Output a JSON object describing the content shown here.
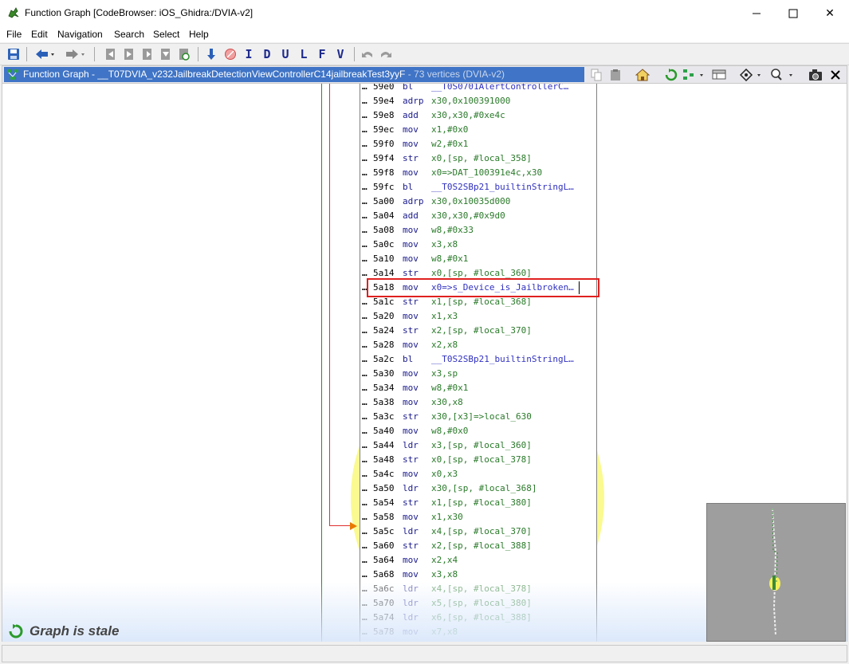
{
  "window": {
    "title": "Function Graph [CodeBrowser: iOS_Ghidra:/DVIA-v2]",
    "minimize_icon": "minimize-icon",
    "maximize_icon": "maximize-icon",
    "close_glyph": "✕"
  },
  "menu": [
    "File",
    "Edit",
    "Navigation",
    "Search",
    "Select",
    "Help"
  ],
  "toolbar": {
    "letters": [
      "I",
      "D",
      "U",
      "L",
      "F",
      "V"
    ]
  },
  "graph_header": {
    "title": "Function Graph - __T07DVIA_v232JailbreakDetectionViewControllerC14jailbreakTest3yyF",
    "vertices": " - 73 vertices  (DVIA-v2)"
  },
  "code": [
    {
      "dots": "…",
      "addr": "59e0",
      "mnemonic": "bl",
      "operands": "__T0S0701AlertControllerC…",
      "kind": "lbl"
    },
    {
      "dots": "…",
      "addr": "59e4",
      "mnemonic": "adrp",
      "operands": "x30,0x100391000",
      "kind": "num"
    },
    {
      "dots": "…",
      "addr": "59e8",
      "mnemonic": "add",
      "operands": "x30,x30,#0xe4c",
      "kind": "num"
    },
    {
      "dots": "…",
      "addr": "59ec",
      "mnemonic": "mov",
      "operands": "x1,#0x0",
      "kind": "num"
    },
    {
      "dots": "…",
      "addr": "59f0",
      "mnemonic": "mov",
      "operands": "w2,#0x1",
      "kind": "num"
    },
    {
      "dots": "…",
      "addr": "59f4",
      "mnemonic": "str",
      "operands": "x0,[sp, #local_358]",
      "kind": "num"
    },
    {
      "dots": "…",
      "addr": "59f8",
      "mnemonic": "mov",
      "operands": "x0=>DAT_100391e4c,x30",
      "kind": "num"
    },
    {
      "dots": "…",
      "addr": "59fc",
      "mnemonic": "bl",
      "operands": "__T0S2SBp21_builtinStringL…",
      "kind": "lbl"
    },
    {
      "dots": "…",
      "addr": "5a00",
      "mnemonic": "adrp",
      "operands": "x30,0x10035d000",
      "kind": "num"
    },
    {
      "dots": "…",
      "addr": "5a04",
      "mnemonic": "add",
      "operands": "x30,x30,#0x9d0",
      "kind": "num"
    },
    {
      "dots": "…",
      "addr": "5a08",
      "mnemonic": "mov",
      "operands": "w8,#0x33",
      "kind": "num"
    },
    {
      "dots": "…",
      "addr": "5a0c",
      "mnemonic": "mov",
      "operands": "x3,x8",
      "kind": "num"
    },
    {
      "dots": "…",
      "addr": "5a10",
      "mnemonic": "mov",
      "operands": "w8,#0x1",
      "kind": "num"
    },
    {
      "dots": "…",
      "addr": "5a14",
      "mnemonic": "str",
      "operands": "x0,[sp, #local_360]",
      "kind": "num"
    },
    {
      "dots": "…",
      "addr": "5a18",
      "mnemonic": "mov",
      "operands": "x0=>s_Device_is_Jailbroken…",
      "kind": "lbl"
    },
    {
      "dots": "…",
      "addr": "5a1c",
      "mnemonic": "str",
      "operands": "x1,[sp, #local_368]",
      "kind": "num"
    },
    {
      "dots": "…",
      "addr": "5a20",
      "mnemonic": "mov",
      "operands": "x1,x3",
      "kind": "num"
    },
    {
      "dots": "…",
      "addr": "5a24",
      "mnemonic": "str",
      "operands": "x2,[sp, #local_370]",
      "kind": "num"
    },
    {
      "dots": "…",
      "addr": "5a28",
      "mnemonic": "mov",
      "operands": "x2,x8",
      "kind": "num"
    },
    {
      "dots": "…",
      "addr": "5a2c",
      "mnemonic": "bl",
      "operands": "__T0S2SBp21_builtinStringL…",
      "kind": "lbl"
    },
    {
      "dots": "…",
      "addr": "5a30",
      "mnemonic": "mov",
      "operands": "x3,sp",
      "kind": "num"
    },
    {
      "dots": "…",
      "addr": "5a34",
      "mnemonic": "mov",
      "operands": "w8,#0x1",
      "kind": "num"
    },
    {
      "dots": "…",
      "addr": "5a38",
      "mnemonic": "mov",
      "operands": "x30,x8",
      "kind": "num"
    },
    {
      "dots": "…",
      "addr": "5a3c",
      "mnemonic": "str",
      "operands": "x30,[x3]=>local_630",
      "kind": "num"
    },
    {
      "dots": "…",
      "addr": "5a40",
      "mnemonic": "mov",
      "operands": "w8,#0x0",
      "kind": "num"
    },
    {
      "dots": "…",
      "addr": "5a44",
      "mnemonic": "ldr",
      "operands": "x3,[sp, #local_360]",
      "kind": "num"
    },
    {
      "dots": "…",
      "addr": "5a48",
      "mnemonic": "str",
      "operands": "x0,[sp, #local_378]",
      "kind": "num"
    },
    {
      "dots": "…",
      "addr": "5a4c",
      "mnemonic": "mov",
      "operands": "x0,x3",
      "kind": "num"
    },
    {
      "dots": "…",
      "addr": "5a50",
      "mnemonic": "ldr",
      "operands": "x30,[sp, #local_368]",
      "kind": "num"
    },
    {
      "dots": "…",
      "addr": "5a54",
      "mnemonic": "str",
      "operands": "x1,[sp, #local_380]",
      "kind": "num"
    },
    {
      "dots": "…",
      "addr": "5a58",
      "mnemonic": "mov",
      "operands": "x1,x30",
      "kind": "num"
    },
    {
      "dots": "…",
      "addr": "5a5c",
      "mnemonic": "ldr",
      "operands": "x4,[sp, #local_370]",
      "kind": "num"
    },
    {
      "dots": "…",
      "addr": "5a60",
      "mnemonic": "str",
      "operands": "x2,[sp, #local_388]",
      "kind": "num"
    },
    {
      "dots": "…",
      "addr": "5a64",
      "mnemonic": "mov",
      "operands": "x2,x4",
      "kind": "num"
    },
    {
      "dots": "…",
      "addr": "5a68",
      "mnemonic": "mov",
      "operands": "x3,x8",
      "kind": "num"
    },
    {
      "dots": "…",
      "addr": "5a6c",
      "mnemonic": "ldr",
      "operands": "x4,[sp, #local_378]",
      "kind": "num"
    },
    {
      "dots": "…",
      "addr": "5a70",
      "mnemonic": "ldr",
      "operands": "x5,[sp, #local_380]",
      "kind": "num"
    },
    {
      "dots": "…",
      "addr": "5a74",
      "mnemonic": "ldr",
      "operands": "x6,[sp, #local_388]",
      "kind": "num"
    },
    {
      "dots": "…",
      "addr": "5a78",
      "mnemonic": "mov",
      "operands": "x7,x8",
      "kind": "num"
    }
  ],
  "status": {
    "stale": "Graph is stale"
  },
  "colors": {
    "header_blue": "#3f74c6",
    "highlight_red": "#e02020",
    "glow_yellow": "#fafa90",
    "operand_green": "#2a7a2a",
    "label_blue": "#3030c0"
  }
}
